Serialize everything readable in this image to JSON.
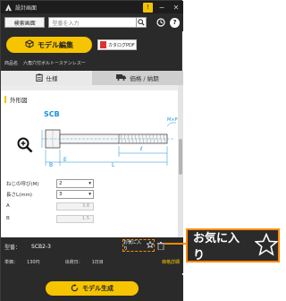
{
  "window": {
    "title": "設計画面",
    "pin": "!",
    "minimize": "−",
    "close": "✕"
  },
  "search": {
    "button_label": "検索画面",
    "placeholder": "型番を入力",
    "help": "?"
  },
  "toolbar": {
    "model_edit_label": "モデル編集",
    "catalog_label": "カタログPDF"
  },
  "product": {
    "label": "商品名",
    "name": "六角穴付ボルトーステンレス一"
  },
  "tabs": [
    {
      "label": "仕様"
    },
    {
      "label": "価格 / 納期"
    }
  ],
  "spec": {
    "section_title": "外形図",
    "series_code": "SCB",
    "dims": {
      "m_x_p": "M×P",
      "b": "B",
      "e": "E",
      "l": "L",
      "l_small": "ℓ"
    },
    "fields": [
      {
        "label": "ねじの呼び(M)",
        "value": "2"
      },
      {
        "label": "長さL(mm)",
        "value": "3"
      },
      {
        "label": "A",
        "value": "3.8"
      },
      {
        "label": "B",
        "value": "1.5"
      }
    ]
  },
  "info": {
    "part_label": "型番：",
    "part_value": "SCB2-3",
    "favorite_label": "お気に入り",
    "price_label": "単価：",
    "price_value": "130円",
    "ship_label": "出荷日：",
    "ship_value": "1日目",
    "price_detail_link": "価格詳細"
  },
  "generate_label": "モデル生成",
  "callout_label": "お気に入り",
  "colors": {
    "accent": "#f6c400",
    "highlight": "#ff8a00",
    "dark": "#2a2a2a",
    "drawing_blue": "#1a8fd6"
  }
}
